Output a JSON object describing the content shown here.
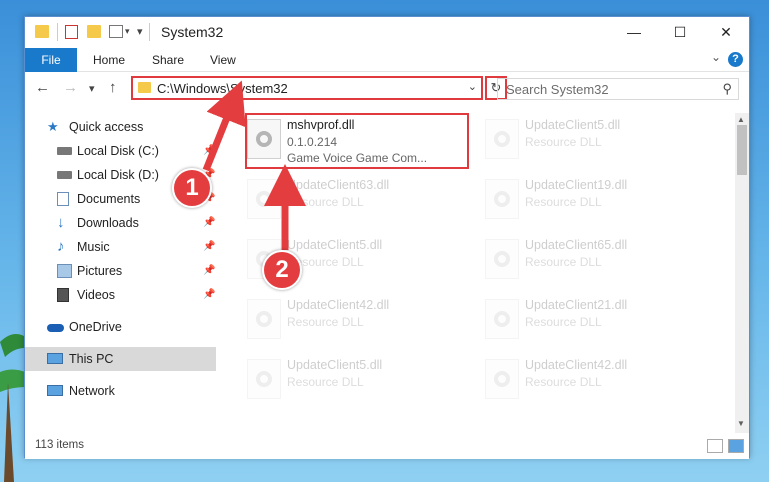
{
  "window": {
    "title": "System32",
    "controls": {
      "minimize": "—",
      "maximize": "☐",
      "close": "✕"
    }
  },
  "ribbon": {
    "tabs": [
      "File",
      "Home",
      "Share",
      "View"
    ],
    "help": "?"
  },
  "navigation": {
    "back": "←",
    "forward": "→",
    "recent": "▾",
    "up": "↑",
    "address": "C:\\Windows\\System32",
    "refresh": "↻",
    "search_placeholder": "Search System32"
  },
  "sidebar": {
    "items": [
      {
        "label": "Quick access",
        "icon": "star-icon",
        "pinned": false
      },
      {
        "label": "Local Disk (C:)",
        "icon": "drive-icon",
        "pinned": true
      },
      {
        "label": "Local Disk (D:)",
        "icon": "drive-icon",
        "pinned": true
      },
      {
        "label": "Documents",
        "icon": "documents-icon",
        "pinned": true
      },
      {
        "label": "Downloads",
        "icon": "download-icon",
        "pinned": true
      },
      {
        "label": "Music",
        "icon": "music-icon",
        "pinned": true
      },
      {
        "label": "Pictures",
        "icon": "pictures-icon",
        "pinned": true
      },
      {
        "label": "Videos",
        "icon": "videos-icon",
        "pinned": true
      },
      {
        "label": "OneDrive",
        "icon": "cloud-icon",
        "pinned": false
      },
      {
        "label": "This PC",
        "icon": "computer-icon",
        "pinned": false,
        "selected": true
      },
      {
        "label": "Network",
        "icon": "network-icon",
        "pinned": false
      }
    ]
  },
  "files": [
    {
      "name": "mshvprof.dll",
      "line2": "0.1.0.214",
      "line3": "Game Voice Game Com...",
      "highlighted": true
    },
    {
      "name": "UpdateClient5.dll",
      "line2": "Resource DLL"
    },
    {
      "name": "UpdateClient63.dll",
      "line2": "Resource DLL"
    },
    {
      "name": "UpdateClient19.dll",
      "line2": "Resource DLL"
    },
    {
      "name": "UpdateClient5.dll",
      "line2": "Resource DLL"
    },
    {
      "name": "UpdateClient65.dll",
      "line2": "Resource DLL"
    },
    {
      "name": "UpdateClient42.dll",
      "line2": "Resource DLL"
    },
    {
      "name": "UpdateClient21.dll",
      "line2": "Resource DLL"
    },
    {
      "name": "UpdateClient5.dll",
      "line2": "Resource DLL"
    },
    {
      "name": "UpdateClient42.dll",
      "line2": "Resource DLL"
    }
  ],
  "status": {
    "count": "113 items"
  },
  "annotations": {
    "step1": "1",
    "step2": "2",
    "color": "#e43d3f"
  }
}
